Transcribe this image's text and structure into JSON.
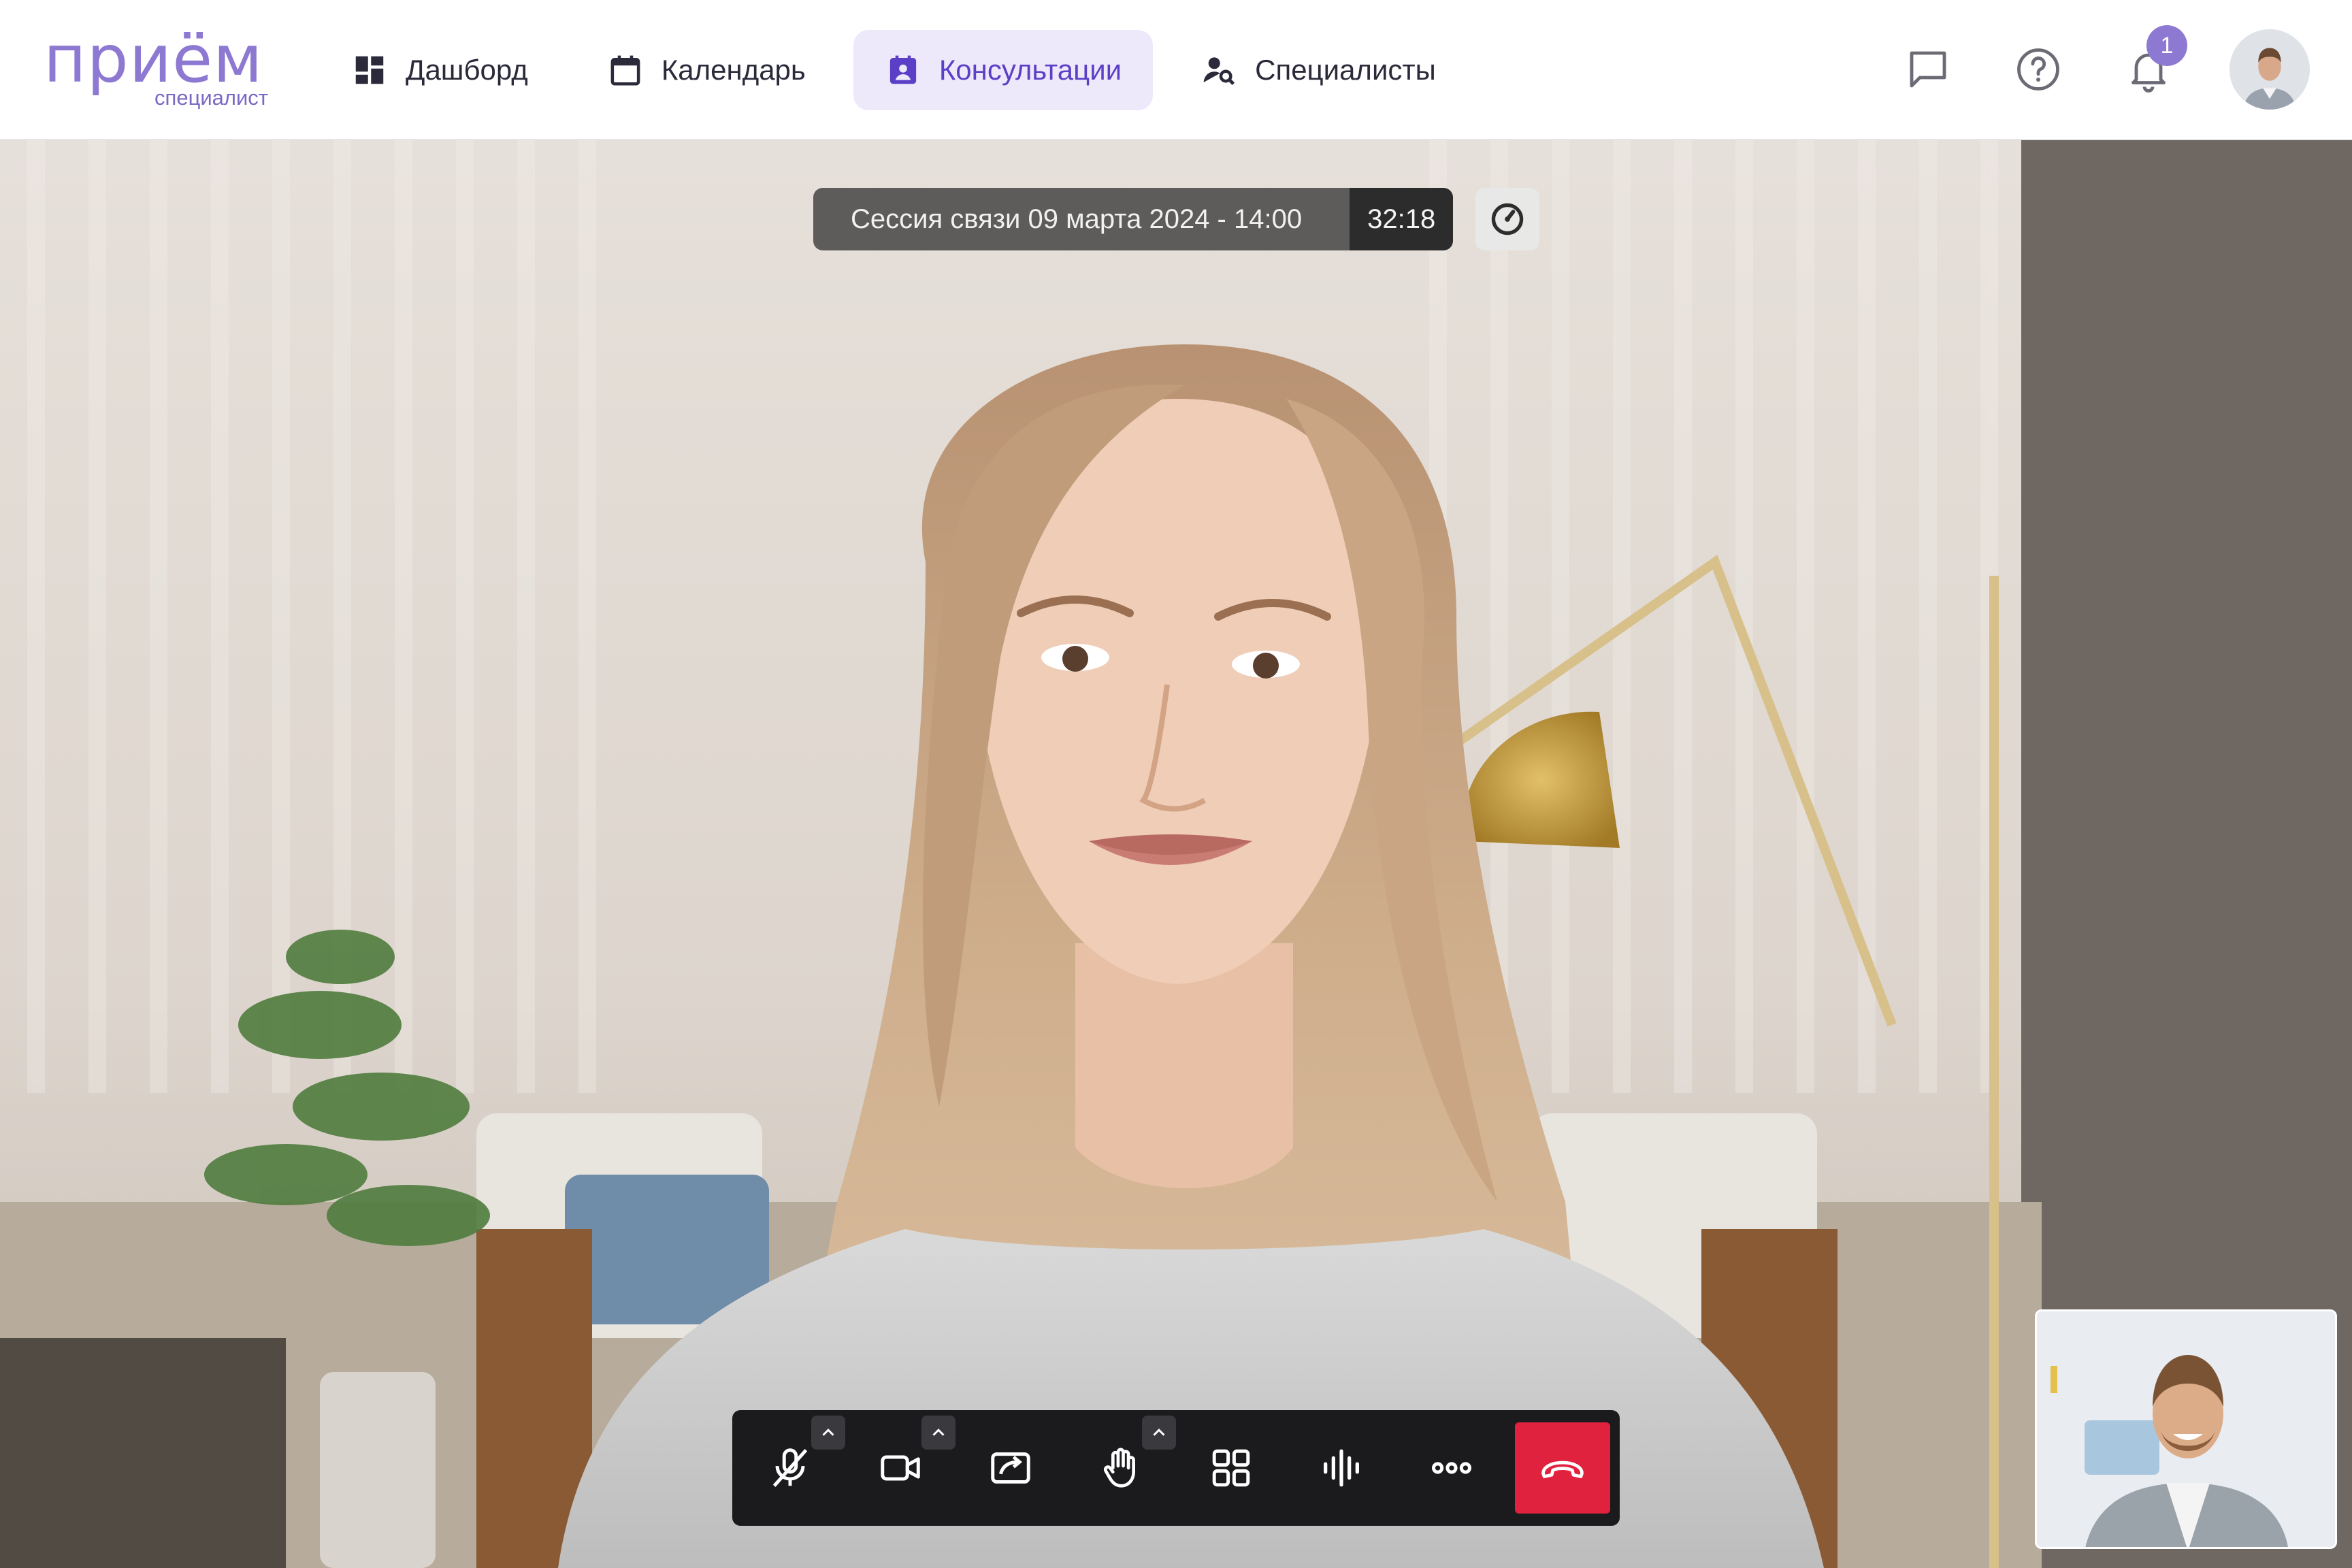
{
  "app": {
    "logo_word": "приём",
    "logo_sub": "специалист",
    "brand_color": "#8e79d2"
  },
  "nav": {
    "items": [
      {
        "label": "Дашборд",
        "icon": "dashboard-icon",
        "active": false
      },
      {
        "label": "Календарь",
        "icon": "calendar-icon",
        "active": false
      },
      {
        "label": "Консультации",
        "icon": "consultation-icon",
        "active": true
      },
      {
        "label": "Специалисты",
        "icon": "specialist-search-icon",
        "active": false
      }
    ]
  },
  "header_actions": {
    "chat_icon": "chat-icon",
    "help_icon": "help-icon",
    "notification_icon": "bell-icon",
    "notification_count": "1",
    "avatar": "user-avatar"
  },
  "call": {
    "session_title": "Сессия связи 09 марта 2024 - 14:00",
    "timer": "32:18",
    "speed_icon": "connection-speed-icon",
    "controls": [
      {
        "icon": "mic-off-icon",
        "has_menu": true
      },
      {
        "icon": "camera-icon",
        "has_menu": true
      },
      {
        "icon": "share-screen-icon",
        "has_menu": false
      },
      {
        "icon": "raise-hand-icon",
        "has_menu": true
      },
      {
        "icon": "grid-layout-icon",
        "has_menu": false
      },
      {
        "icon": "audio-wave-icon",
        "has_menu": false
      },
      {
        "icon": "more-icon",
        "has_menu": false
      },
      {
        "icon": "end-call-icon",
        "has_menu": false
      }
    ],
    "end_call_color": "#e0223f"
  }
}
